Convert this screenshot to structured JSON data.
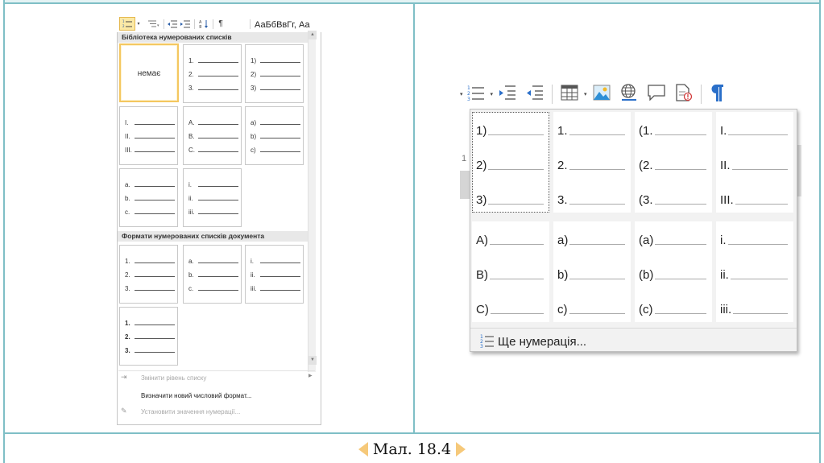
{
  "word_gallery": {
    "ribbon": {
      "styles_preview": "АаБбВвГг, Аа"
    },
    "library_section_title": "Бібліотека нумерованих списків",
    "none_label": "немає",
    "library_tiles": [
      {
        "rows": [
          "1.",
          "2.",
          "3."
        ]
      },
      {
        "rows": [
          "1)",
          "2)",
          "3)"
        ]
      },
      {
        "rows": [
          "I.",
          "II.",
          "III."
        ]
      },
      {
        "rows": [
          "A.",
          "B.",
          "C."
        ]
      },
      {
        "rows": [
          "a)",
          "b)",
          "c)"
        ]
      },
      {
        "rows": [
          "a.",
          "b.",
          "c."
        ]
      },
      {
        "rows": [
          "i.",
          "ii.",
          "iii."
        ]
      }
    ],
    "document_section_title": "Формати нумерованих списків документа",
    "document_tiles": [
      {
        "rows": [
          "1.",
          "2.",
          "3."
        ]
      },
      {
        "rows": [
          "a.",
          "b.",
          "c."
        ]
      },
      {
        "rows": [
          "i.",
          "ii.",
          "iii."
        ]
      },
      {
        "rows": [
          "1.",
          "2.",
          "3."
        ],
        "bold": true
      }
    ],
    "menu": {
      "change_level": "Змінити рівень списку",
      "define_format": "Визначити новий числовий формат...",
      "set_value": "Установити значення нумерації..."
    }
  },
  "lo_panel": {
    "top_tiles": [
      {
        "rows": [
          "1)",
          "2)",
          "3)"
        ]
      },
      {
        "rows": [
          "1.",
          "2.",
          "3."
        ]
      },
      {
        "rows": [
          "(1.",
          "(2.",
          "(3."
        ]
      },
      {
        "rows": [
          "I.",
          "II.",
          "III."
        ]
      }
    ],
    "bottom_tiles": [
      {
        "rows": [
          "A)",
          "B)",
          "C)"
        ]
      },
      {
        "rows": [
          "a)",
          "b)",
          "c)"
        ]
      },
      {
        "rows": [
          "(a)",
          "(b)",
          "(c)"
        ]
      },
      {
        "rows": [
          "i.",
          "ii.",
          "iii."
        ]
      }
    ],
    "more_label": "Ще нумерація...",
    "behind_digit": "1"
  },
  "caption": "Мал. 18.4",
  "colors": {
    "frame": "#7fbfc6",
    "selection": "#f4c760",
    "caption_arrows": "#f6c97a"
  }
}
